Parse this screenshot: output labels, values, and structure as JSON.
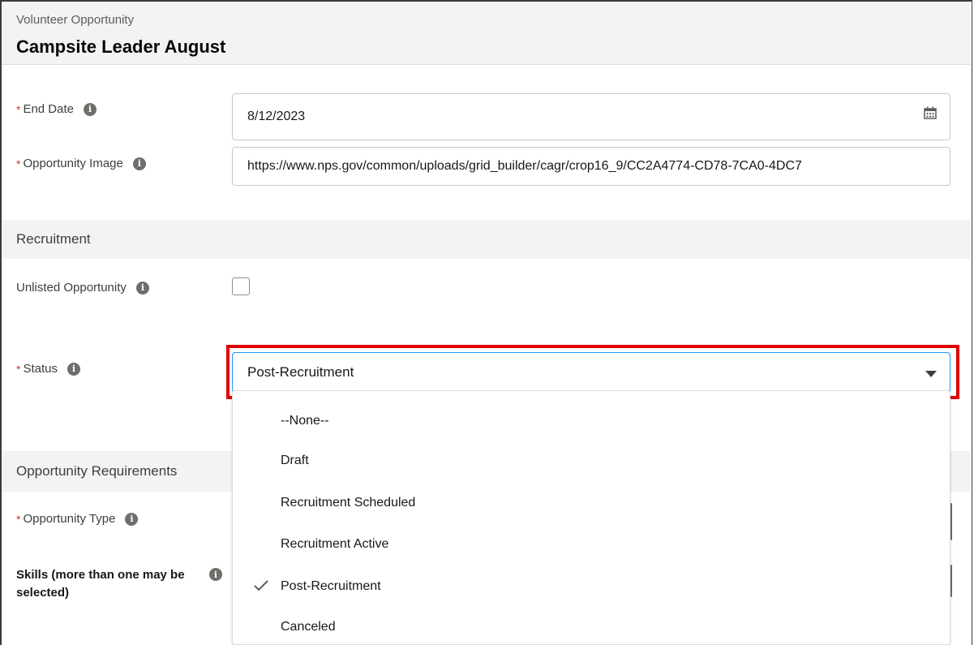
{
  "header": {
    "object_label": "Volunteer Opportunity",
    "record_title": "Campsite Leader August"
  },
  "fields": {
    "end_date": {
      "label": "End Date",
      "required_mark": "*",
      "value": "8/12/2023",
      "icon": "calendar-icon"
    },
    "opportunity_image": {
      "label": "Opportunity Image",
      "required_mark": "*",
      "value": "https://www.nps.gov/common/uploads/grid_builder/cagr/crop16_9/CC2A4774-CD78-7CA0-4DC7"
    },
    "unlisted_opportunity": {
      "label": "Unlisted Opportunity",
      "checked": false
    },
    "status": {
      "label": "Status",
      "required_mark": "*",
      "value": "Post-Recruitment"
    },
    "opportunity_type": {
      "label": "Opportunity Type",
      "required_mark": "*"
    },
    "skills": {
      "label": "Skills (more than one may be selected)"
    }
  },
  "sections": {
    "recruitment": "Recruitment",
    "requirements": "Opportunity Requirements"
  },
  "status_dropdown": {
    "options": [
      "--None--",
      "Draft",
      "Recruitment Scheduled",
      "Recruitment Active",
      "Post-Recruitment",
      "Canceled"
    ],
    "selected": "Post-Recruitment"
  },
  "colors": {
    "highlight": "#e00000",
    "required": "#c23934",
    "focus_border": "#1b96ff"
  }
}
